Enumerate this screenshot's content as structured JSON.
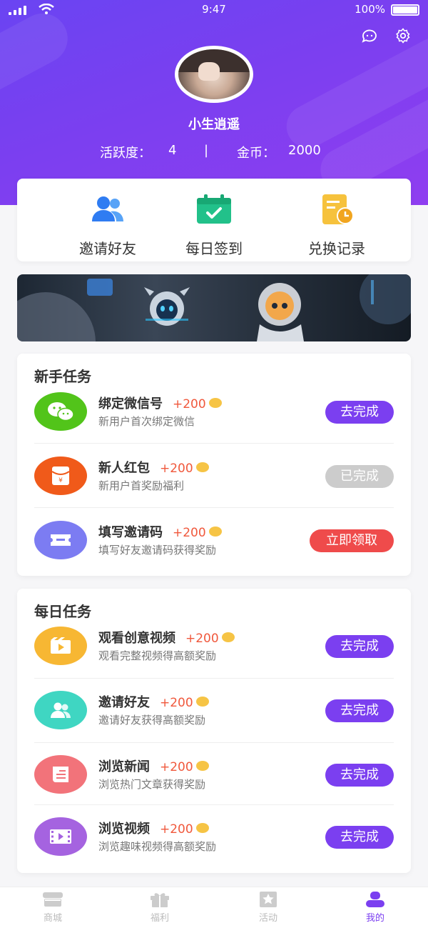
{
  "status_bar": {
    "time": "9:47",
    "battery": "100%"
  },
  "header_icons": [
    "chat-icon",
    "gear-icon"
  ],
  "user": {
    "name": "小生逍遥",
    "activity_label": "活跃度：",
    "activity_value": "4",
    "separator": "|",
    "coins_label": "金币：",
    "coins_value": "2000"
  },
  "quick_actions": [
    {
      "label": "邀请好友",
      "icon": "users-icon"
    },
    {
      "label": "每日签到",
      "icon": "calendar-check-icon"
    },
    {
      "label": "兑换记录",
      "icon": "record-icon"
    }
  ],
  "newbie_tasks": {
    "title": "新手任务",
    "items": [
      {
        "name": "绑定微信号",
        "reward": "+200",
        "desc": "新用户首次绑定微信",
        "button": "去完成",
        "icon": "wechat-icon",
        "icon_color": "#52c41a",
        "button_color": "#7b3ff0"
      },
      {
        "name": "新人红包",
        "reward": "+200",
        "desc": "新用户首奖励福利",
        "button": "已完成",
        "icon": "red-envelope-icon",
        "icon_color": "#f05a1a",
        "button_color": "#cccccc"
      },
      {
        "name": "填写邀请码",
        "reward": "+200",
        "desc": "填写好友邀请码获得奖励",
        "button": "立即领取",
        "icon": "ticket-icon",
        "icon_color": "#7c7cf2",
        "button_color": "#ef4b4b"
      }
    ]
  },
  "daily_tasks": {
    "title": "每日任务",
    "items": [
      {
        "name": "观看创意视频",
        "reward": "+200",
        "desc": "观看完整视频得高额奖励",
        "button": "去完成",
        "icon": "video-icon",
        "icon_color": "#f7b733",
        "button_color": "#7b3ff0"
      },
      {
        "name": "邀请好友",
        "reward": "+200",
        "desc": "邀请好友获得高额奖励",
        "button": "去完成",
        "icon": "users-icon",
        "icon_color": "#3fd6c2",
        "button_color": "#7b3ff0"
      },
      {
        "name": "浏览新闻",
        "reward": "+200",
        "desc": "浏览热门文章获得奖励",
        "button": "去完成",
        "icon": "news-icon",
        "icon_color": "#f2737a",
        "button_color": "#7b3ff0"
      },
      {
        "name": "浏览视频",
        "reward": "+200",
        "desc": "浏览趣味视频得高额奖励",
        "button": "去完成",
        "icon": "film-icon",
        "icon_color": "#a563e0",
        "button_color": "#7b3ff0"
      }
    ]
  },
  "tabbar": [
    {
      "label": "商城",
      "icon": "shop-icon",
      "active": false
    },
    {
      "label": "福利",
      "icon": "gift-icon",
      "active": false
    },
    {
      "label": "活动",
      "icon": "star-icon",
      "active": false
    },
    {
      "label": "我的",
      "icon": "user-icon",
      "active": true
    }
  ]
}
